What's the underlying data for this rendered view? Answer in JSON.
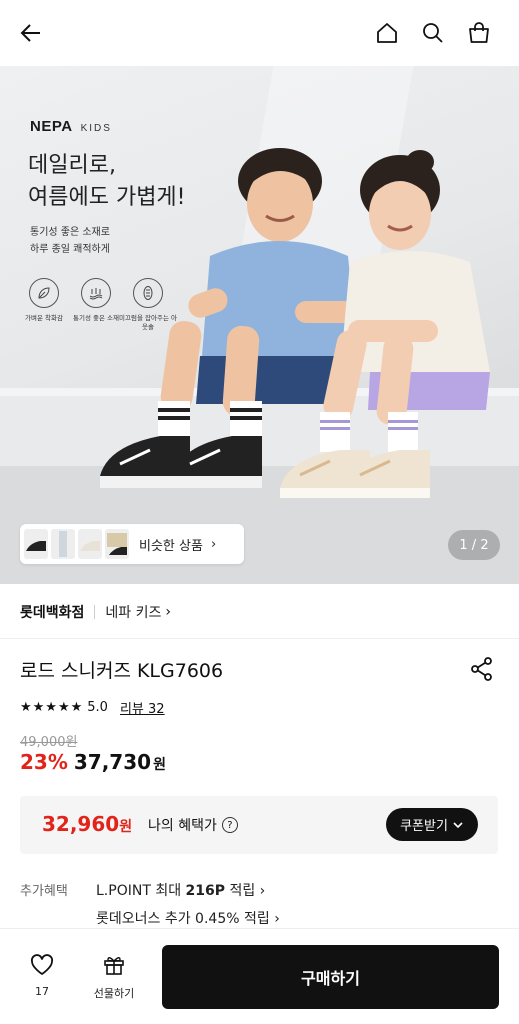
{
  "hero": {
    "logo_brand": "NEPA",
    "logo_sub": "KIDS",
    "headline_line1": "데일리로,",
    "headline_line2": "여름에도 가볍게!",
    "sub_line1": "통기성 좋은 소재로",
    "sub_line2": "하루 종일 쾌적하게",
    "features": [
      {
        "icon": "leaf-icon",
        "label": "가벼운 착화감"
      },
      {
        "icon": "breathable-icon",
        "label": "통기성 좋은 소재"
      },
      {
        "icon": "grip-icon",
        "label": "미끄럼을 잡아주는 아웃솔"
      }
    ],
    "similar_label": "비슷한 상품",
    "pager": "1 / 2"
  },
  "brand": {
    "store": "롯데백화점",
    "sub": "네파 키즈"
  },
  "product": {
    "title": "로드 스니커즈 KLG7606",
    "stars": "★★★★★",
    "rating": "5.0",
    "review": "리뷰 32",
    "original_price": "49,000원",
    "discount": "23%",
    "price": "37,730",
    "won": "원"
  },
  "benefit": {
    "price": "32,960",
    "won": "원",
    "label": "나의 혜택가",
    "coupon_button": "쿠폰받기"
  },
  "extra": {
    "label": "추가혜택",
    "line1_prefix": "L.POINT 최대 ",
    "line1_bold": "216P",
    "line1_suffix": " 적립 ›",
    "line2": "롯데오너스 추가 0.45% 적립 ›"
  },
  "bottom": {
    "like_count": "17",
    "gift_label": "선물하기",
    "buy_label": "구매하기"
  },
  "colors": {
    "accent_red": "#e2231a",
    "dark": "#111111"
  }
}
